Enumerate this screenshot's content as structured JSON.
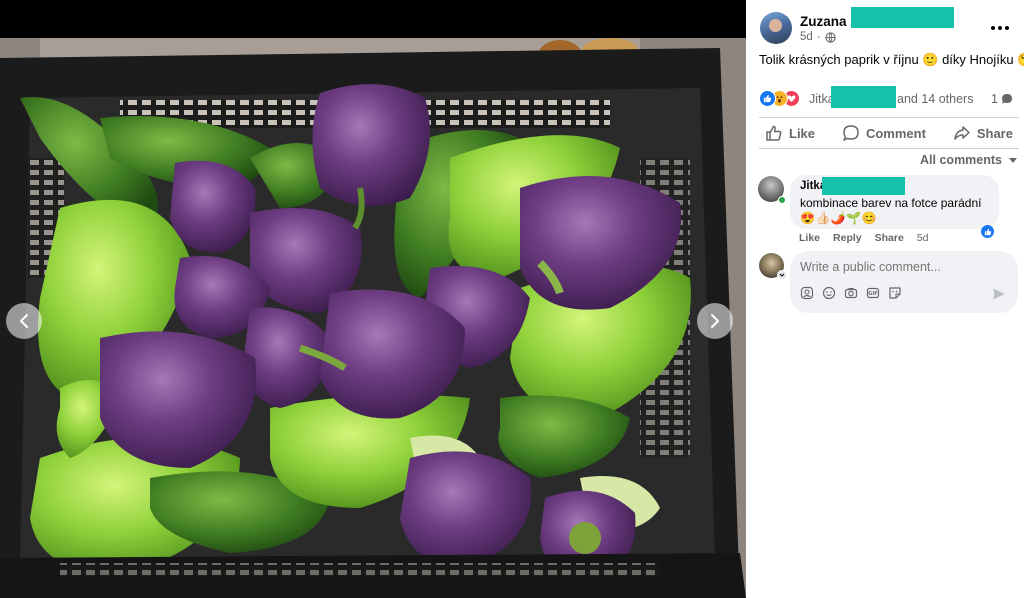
{
  "viewer": {
    "prev_icon": "chevron-left-icon",
    "next_icon": "chevron-right-icon"
  },
  "post": {
    "author": "Zuzana",
    "time": "5d",
    "privacy_icon": "globe-icon",
    "text": "Tolik krásných paprik v říjnu 🙂 díky Hnojíku 😘",
    "reactions": {
      "types": [
        "like",
        "wow",
        "love"
      ],
      "first_name": "Jitka",
      "others_text": "and 14 others",
      "comment_count": "1"
    },
    "actions": {
      "like": "Like",
      "comment": "Comment",
      "share": "Share"
    },
    "sort_label": "All comments"
  },
  "comment": {
    "author": "Jitka",
    "text": "kombinace barev na fotce parádní",
    "emoji": "😍👍🏻🌶️🌱😊",
    "actions": {
      "like": "Like",
      "reply": "Reply",
      "share": "Share",
      "time": "5d"
    },
    "reaction": "like"
  },
  "composer": {
    "placeholder": "Write a public comment...",
    "tools": [
      "avatar-sticker-icon",
      "emoji-icon",
      "camera-icon",
      "gif-icon",
      "sticker-icon"
    ]
  },
  "colors": {
    "facebook_blue": "#1877f2",
    "redaction": "#17c2ad",
    "secondary_text": "#65676b",
    "bubble_bg": "#f0f2f5"
  }
}
